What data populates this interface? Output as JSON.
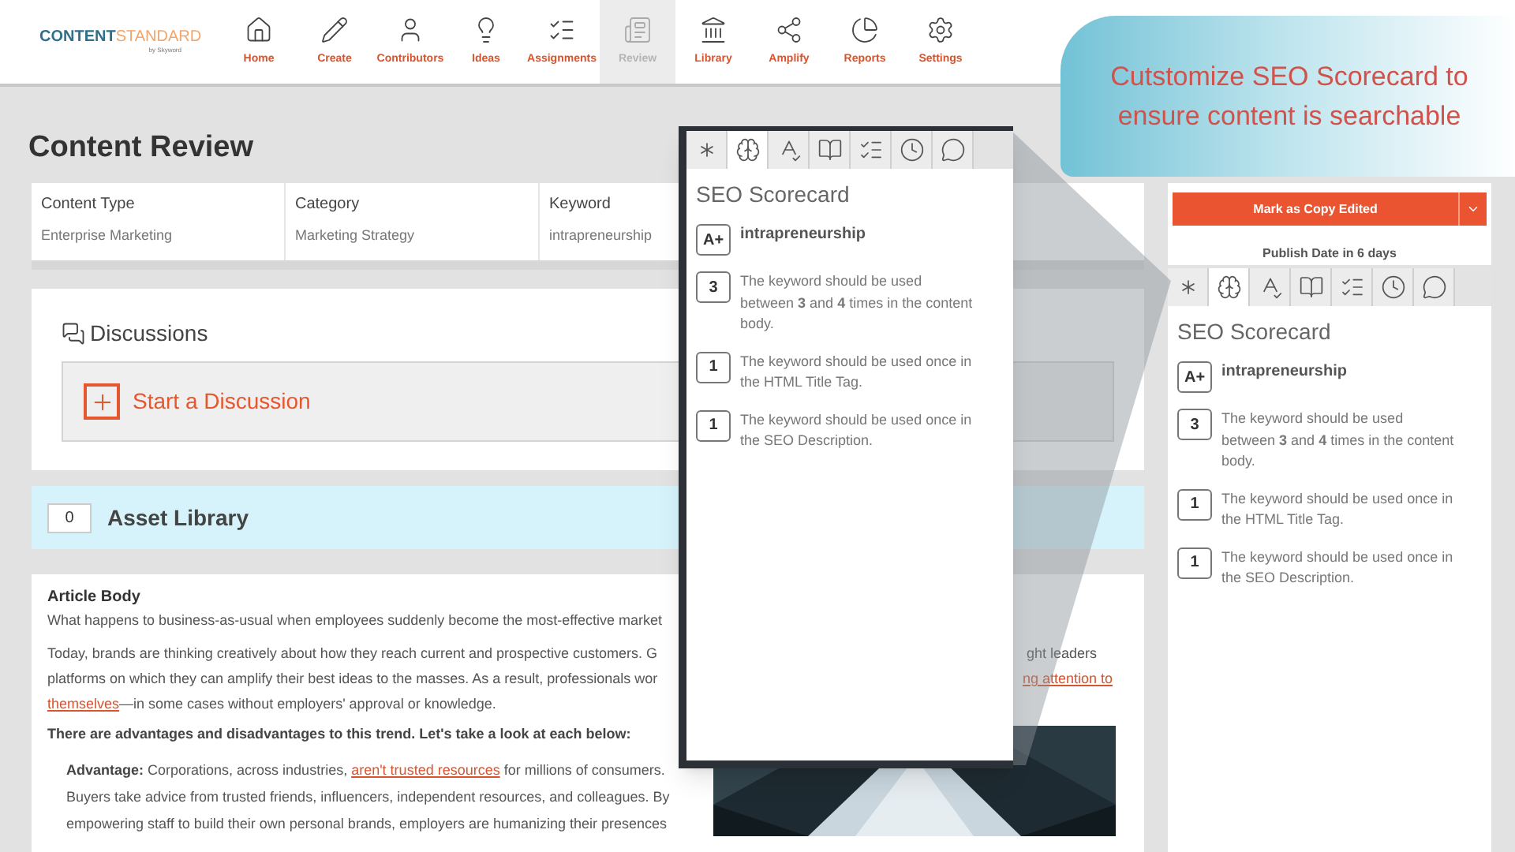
{
  "logo": {
    "word_1": "CONTENT",
    "word_2": "STANDARD",
    "byline": "by Skyword"
  },
  "nav": [
    {
      "label": "Home",
      "selected": false
    },
    {
      "label": "Create",
      "selected": false
    },
    {
      "label": "Contributors",
      "selected": false
    },
    {
      "label": "Ideas",
      "selected": false
    },
    {
      "label": "Assignments",
      "selected": false
    },
    {
      "label": "Review",
      "selected": true
    },
    {
      "label": "Library",
      "selected": false
    },
    {
      "label": "Amplify",
      "selected": false
    },
    {
      "label": "Reports",
      "selected": false
    },
    {
      "label": "Settings",
      "selected": false
    }
  ],
  "page_title": "Content Review",
  "info": [
    {
      "label": "Content Type",
      "value": "Enterprise Marketing"
    },
    {
      "label": "Category",
      "value": "Marketing Strategy"
    },
    {
      "label": "Keyword",
      "value": "intrapreneurship"
    }
  ],
  "discussions": {
    "title": "Discussions",
    "start_button": "Start a Discussion"
  },
  "asset_library": {
    "count": "0",
    "title": "Asset Library"
  },
  "article": {
    "title": "Article Body",
    "line_1": "What happens to business-as-usual when employees suddenly become the most-effective market",
    "paragraph_2": {
      "line_1_left": "Today, brands are thinking creatively about how they reach current and prospective customers. G",
      "line_1_right": "ght leaders",
      "line_2_left": "platforms on which they can amplify their best ideas to the masses. As a result, professionals wor",
      "line_2_right_link": "ng attention to",
      "line_3_link": "themselves",
      "line_3_rest": "—in some cases without employers' approval or knowledge."
    },
    "lead": "There are advantages and disadvantages to this trend. Let's take a look at each below:",
    "advantage": {
      "label": "Advantage:",
      "before_link": " Corporations, across industries, ",
      "link": "aren't trusted resources",
      "after_link": " for millions of consumers. Buyers take advice from trusted friends, influencers, independent resources, and colleagues. By empowering staff to build their own personal brands, employers are humanizing their presences"
    }
  },
  "right_panel": {
    "mark_button": "Mark as Copy Edited",
    "publish_date": "Publish Date in 6 days",
    "tabs": [
      {
        "selected": false
      },
      {
        "selected": true
      },
      {
        "selected": false
      },
      {
        "selected": false
      },
      {
        "selected": false
      },
      {
        "selected": false
      },
      {
        "selected": false
      }
    ],
    "scorecard": {
      "title": "SEO Scorecard",
      "items": [
        {
          "badge": "A+",
          "text": "**intrapreneurship**",
          "kind": "keyword"
        },
        {
          "badge": "3",
          "text": "The keyword should be used between **3** and **4** times in the content body.",
          "kind": "rule"
        },
        {
          "badge": "1",
          "text": "The keyword should be used once in the HTML Title Tag.",
          "kind": "rule"
        },
        {
          "badge": "1",
          "text": "The keyword should be used once in the SEO Description.",
          "kind": "rule"
        }
      ]
    }
  },
  "zoom_popup": {
    "tabs": [
      {
        "selected": false
      },
      {
        "selected": true
      },
      {
        "selected": false
      },
      {
        "selected": false
      },
      {
        "selected": false
      },
      {
        "selected": false
      },
      {
        "selected": false
      }
    ],
    "scorecard": {
      "title": "SEO Scorecard",
      "items": [
        {
          "badge": "A+",
          "text": "**intrapreneurship**",
          "kind": "keyword"
        },
        {
          "badge": "3",
          "text": "The keyword should be used between **3** and **4** times in the content body.",
          "kind": "rule"
        },
        {
          "badge": "1",
          "text": "The keyword should be used once in the HTML Title Tag.",
          "kind": "rule"
        },
        {
          "badge": "1",
          "text": "The keyword should be used once in the SEO Description.",
          "kind": "rule"
        }
      ]
    }
  },
  "callout": {
    "text": "Cutstomize SEO Scorecard to ensure content is searchable"
  }
}
